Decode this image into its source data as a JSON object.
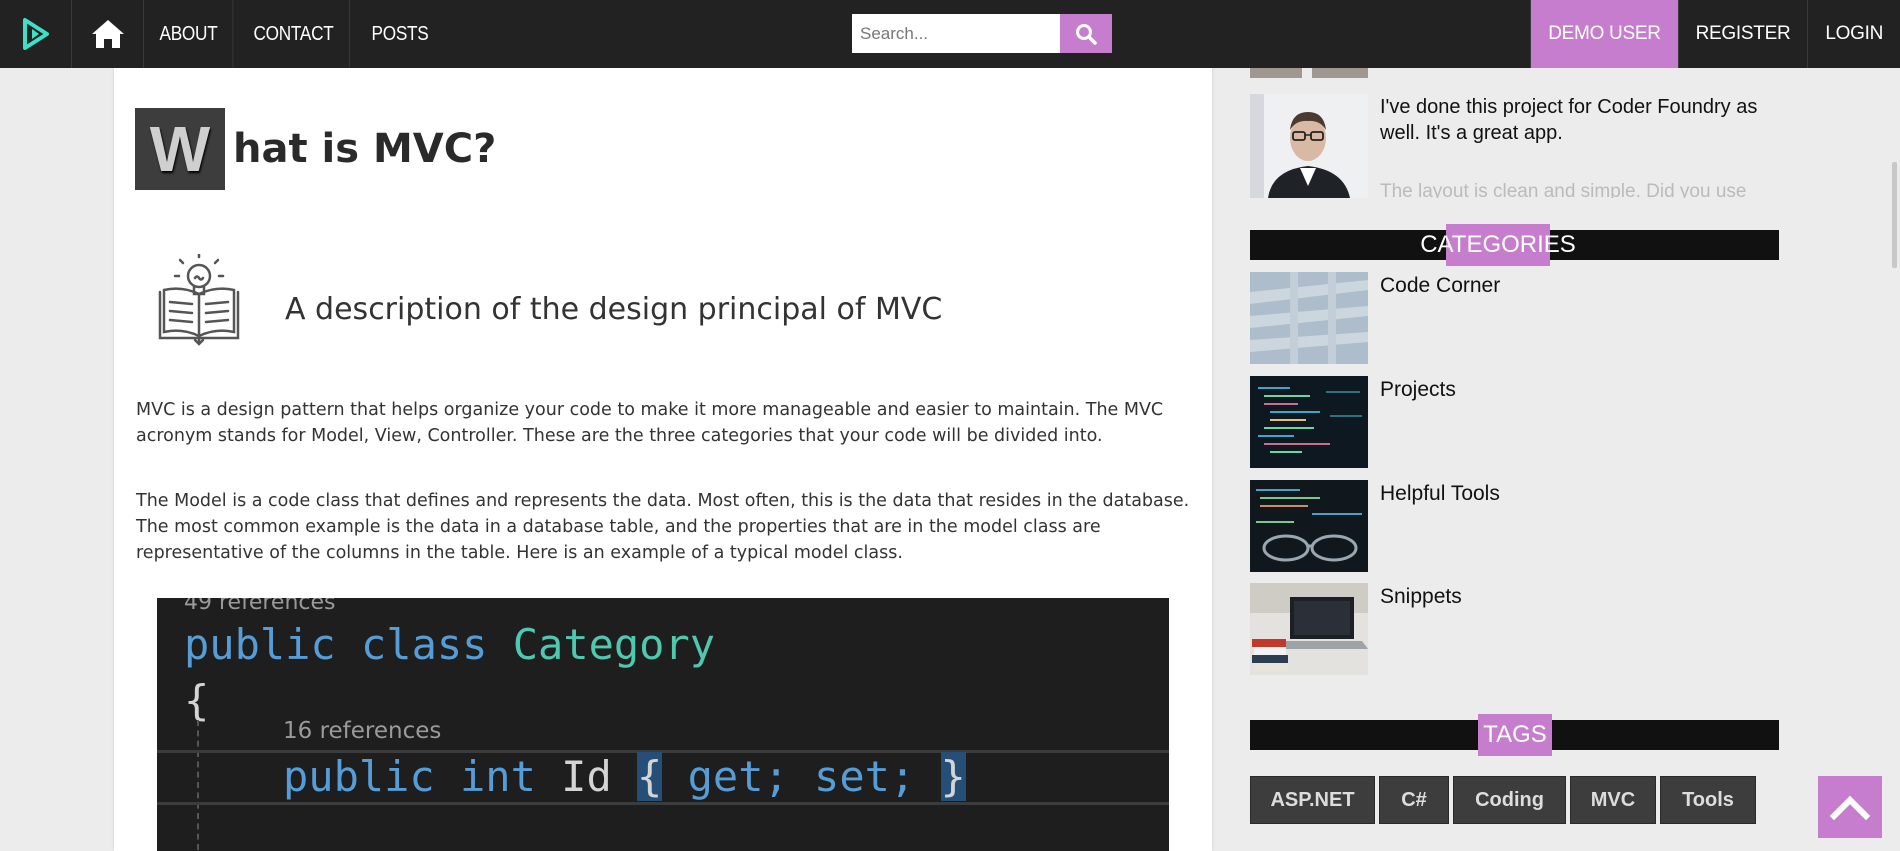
{
  "navbar": {
    "brand_icon": "play-logo-icon",
    "home_icon": "home-icon",
    "links": [
      "ABOUT",
      "CONTACT",
      "POSTS"
    ],
    "search": {
      "placeholder": "Search...",
      "button_icon": "search-icon"
    },
    "right_links": [
      "DEMO USER",
      "REGISTER",
      "LOGIN"
    ],
    "accent_color": "#c77dce"
  },
  "article": {
    "dropcap": "W",
    "title_rest": "hat is MVC?",
    "description_icon": "book-lightbulb-icon",
    "description": "A description of the design principal of MVC",
    "paragraphs": [
      "MVC is a design pattern that helps organize your code to make it more manageable and easier to maintain. The MVC acronym stands for Model, View, Controller. These are the three categories that your code will be divided into.",
      "The Model is a code class that defines and represents the data. Most often, this is the data that resides in the database. The most common example is the data in a database table, and the properties that are in the model class are representative of the columns in the table. Here is an example of a typical model class."
    ],
    "code": {
      "ref_top": "49 references",
      "kw_public": "public",
      "kw_class": "class",
      "class_name": "Category",
      "open_brace": "{",
      "ref_16": "16 references",
      "kw_int": "int",
      "prop_name": "Id",
      "prop_body_open": "{",
      "prop_body": " get; set; ",
      "prop_body_close": "}"
    }
  },
  "sidebar": {
    "comment": {
      "text": "I've done this project for Coder Foundry as well. It's a great app.",
      "faded_text": "The layout is clean and simple. Did you use bootstrap?"
    },
    "categories_title": "CATEGORIES",
    "categories": [
      "Code Corner",
      "Projects",
      "Helpful Tools",
      "Snippets"
    ],
    "tags_title": "TAGS",
    "tags": [
      "ASP.NET",
      "C#",
      "Coding",
      "MVC",
      "Tools"
    ]
  },
  "back_to_top_icon": "chevron-up-icon"
}
